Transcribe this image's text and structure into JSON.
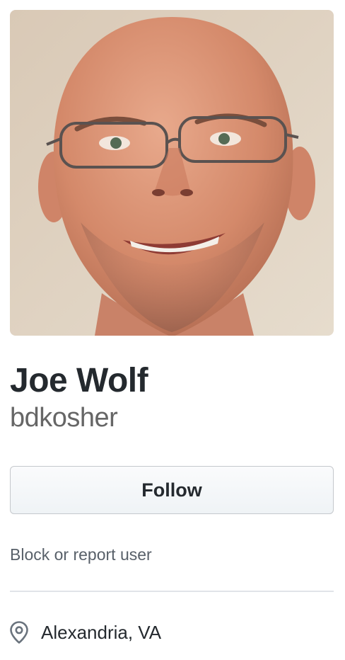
{
  "profile": {
    "full_name": "Joe Wolf",
    "username": "bdkosher",
    "avatar_alt": "Joe Wolf avatar"
  },
  "actions": {
    "follow_label": "Follow",
    "block_label": "Block or report user"
  },
  "details": {
    "location": "Alexandria, VA",
    "location_icon": "location-pin-icon"
  },
  "colors": {
    "primary_text": "#24292e",
    "secondary_text": "#666666",
    "muted_text": "#586069",
    "button_border": "#c5c8cc",
    "divider": "#e1e4e8"
  }
}
